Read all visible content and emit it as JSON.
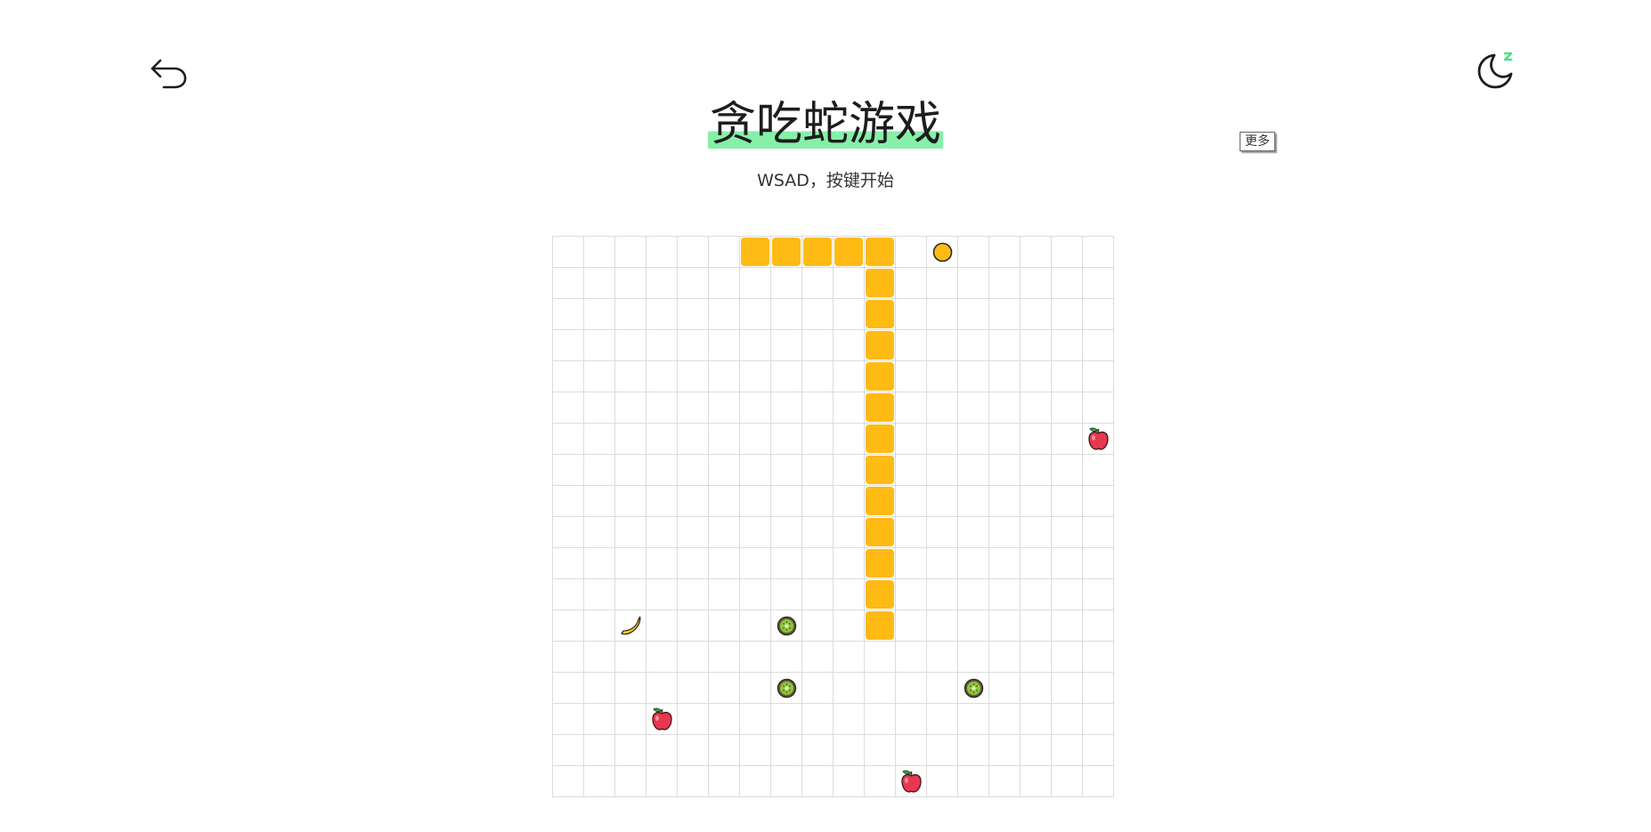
{
  "header": {
    "title": "贪吃蛇游戏",
    "subtitle": "WSAD，按键开始",
    "more_label": "更多",
    "back_icon": "undo-arrow-icon",
    "theme_icon": "moon-sleep-icon"
  },
  "colors": {
    "title_highlight": "#86f0a8",
    "snake": "#ffbb14",
    "grid_line": "#dcdcdc"
  },
  "board": {
    "cols": 18,
    "rows": 18,
    "snake": [
      [
        6,
        0
      ],
      [
        7,
        0
      ],
      [
        8,
        0
      ],
      [
        9,
        0
      ],
      [
        10,
        0
      ],
      [
        10,
        1
      ],
      [
        10,
        2
      ],
      [
        10,
        3
      ],
      [
        10,
        4
      ],
      [
        10,
        5
      ],
      [
        10,
        6
      ],
      [
        10,
        7
      ],
      [
        10,
        8
      ],
      [
        10,
        9
      ],
      [
        10,
        10
      ],
      [
        10,
        11
      ],
      [
        10,
        12
      ]
    ],
    "items": [
      {
        "type": "orange",
        "col": 12,
        "row": 0
      },
      {
        "type": "apple",
        "col": 17,
        "row": 6
      },
      {
        "type": "banana",
        "col": 2,
        "row": 12
      },
      {
        "type": "kiwi",
        "col": 7,
        "row": 12
      },
      {
        "type": "kiwi",
        "col": 7,
        "row": 14
      },
      {
        "type": "kiwi",
        "col": 13,
        "row": 14
      },
      {
        "type": "apple",
        "col": 3,
        "row": 15
      },
      {
        "type": "apple",
        "col": 11,
        "row": 17
      }
    ]
  }
}
